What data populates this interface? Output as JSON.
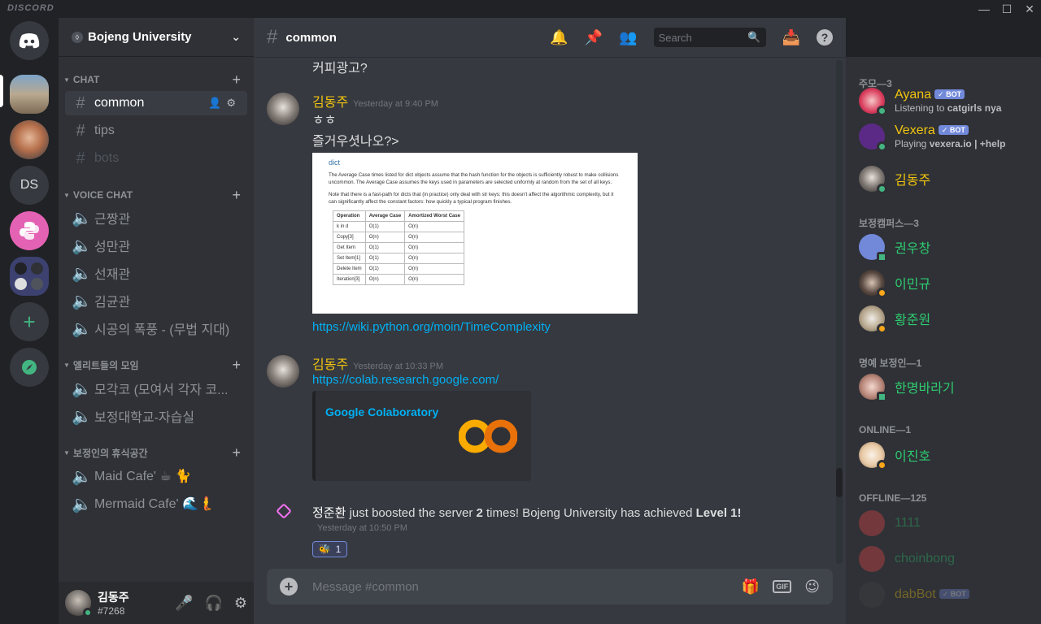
{
  "app": {
    "brand": "DISCORD",
    "window_controls": [
      "—",
      "☐",
      "✕"
    ]
  },
  "guilds": {
    "initials": "DS"
  },
  "server": {
    "name": "Bojeng University"
  },
  "categories": [
    {
      "label": "CHAT"
    },
    {
      "label": "VOICE CHAT"
    },
    {
      "label": "엘리트들의 모임"
    },
    {
      "label": "보정인의 휴식공간"
    }
  ],
  "text_channels": [
    {
      "name": "common"
    },
    {
      "name": "tips"
    },
    {
      "name": "bots"
    }
  ],
  "voice_channels": [
    {
      "name": "근짱관"
    },
    {
      "name": "성만관"
    },
    {
      "name": "선재관"
    },
    {
      "name": "김균관"
    },
    {
      "name": "시공의 폭풍 - (무법 지대)"
    }
  ],
  "elite_channels": [
    {
      "name": "모각코 (모여서 각자 코..."
    },
    {
      "name": "보정대학교-자습실"
    }
  ],
  "rest_channels": [
    {
      "name": "Maid Cafe' ☕ 🐈"
    },
    {
      "name": "Mermaid Cafe' 🌊🧜"
    }
  ],
  "user": {
    "name": "김동주",
    "tag": "#7268"
  },
  "chat": {
    "channel": "common",
    "search_placeholder": "Search",
    "composer_placeholder": "Message #common",
    "messages": [
      {
        "text": "커피광고?"
      },
      {
        "author": "김동주",
        "time": "Yesterday at 9:40 PM",
        "lines": [
          "ㅎㅎ",
          "즐거우셧나오?>"
        ],
        "link": "https://wiki.python.org/moin/TimeComplexity"
      },
      {
        "author": "김동주",
        "time": "Yesterday at 10:33 PM",
        "link": "https://colab.research.google.com/",
        "embed_title": "Google Colaboratory"
      }
    ],
    "boost": {
      "user": "정준환",
      "text_a": " just boosted the server ",
      "count": "2",
      "text_b": " times! Bojeng University has achieved ",
      "level": "Level 1!",
      "time": "Yesterday at 10:50 PM",
      "reaction_count": "1"
    }
  },
  "doc_image": {
    "title": "dict",
    "para1": "The Average Case times listed for dict objects assume that the hash function for the objects is sufficiently robust to make collisions uncommon. The Average Case assumes the keys used in parameters are selected uniformly at random from the set of all keys.",
    "para2": "Note that there is a fast-path for dicts that (in practice) only deal with str keys; this doesn't affect the algorithmic complexity, but it can significantly affect the constant factors: how quickly a typical program finishes.",
    "headers": [
      "Operation",
      "Average Case",
      "Amortized Worst Case"
    ],
    "rows": [
      [
        "k in d",
        "O(1)",
        "O(n)"
      ],
      [
        "Copy[3]",
        "O(n)",
        "O(n)"
      ],
      [
        "Get Item",
        "O(1)",
        "O(n)"
      ],
      [
        "Set Item[1]",
        "O(1)",
        "O(n)"
      ],
      [
        "Delete Item",
        "O(1)",
        "O(n)"
      ],
      [
        "Iteration[3]",
        "O(n)",
        "O(n)"
      ]
    ]
  },
  "members": {
    "groups": [
      "주모—3",
      "보정캠퍼스—3",
      "명예 보정인—1",
      "ONLINE—1",
      "OFFLINE—125"
    ],
    "ayana": {
      "name": "Ayana",
      "sub_pre": "Listening to ",
      "sub_bold": "catgirls nya"
    },
    "vexera": {
      "name": "Vexera",
      "sub_pre": "Playing ",
      "sub_bold": "vexera.io | +help"
    },
    "bot_badge": "✓ BOT",
    "list": [
      "김동주",
      "권우창",
      "이민규",
      "황준원",
      "한명바라기",
      "이진호",
      "1111",
      "choinbong",
      "dabBot"
    ]
  },
  "colors": {
    "accent": "#7289da",
    "online": "#43b581",
    "idle": "#faa61a",
    "link": "#00b0f4",
    "gold": "#f1c40f",
    "green_name": "#2ecc71"
  }
}
